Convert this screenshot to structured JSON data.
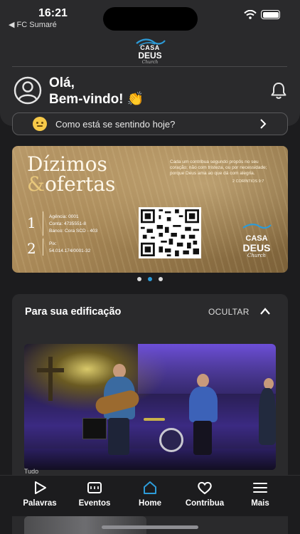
{
  "status": {
    "time": "16:21",
    "back_label": "◀ FC Sumaré"
  },
  "header": {
    "logo_line1": "CASA",
    "logo_line2": "DEUS",
    "logo_script": "Church",
    "greeting_line1": "Olá,",
    "greeting_line2": "Bem-vindo! 👏"
  },
  "mood": {
    "prompt": "Como está se sentindo hoje?"
  },
  "banner": {
    "title_line1": "Dízimos",
    "title_amp": "&",
    "title_line2": "ofertas",
    "verse": "Cada um contribua segundo propôs no seu coração; não com tristeza, ou por necessidade; porque Deus ama ao que dá com alegria.",
    "verse_ref": "2 CORÍNTIOS 9:7",
    "bank_num": "1",
    "bank_agency": "Agência: 0001",
    "bank_account": "Conta: 4735551-8",
    "bank_name": "Banco: Cora SCD - 403",
    "pix_num": "2",
    "pix_label": "Pix:",
    "pix_key": "54.014.174/0001-32",
    "logo_line1": "CASA",
    "logo_line2": "DEUS",
    "logo_script": "Church"
  },
  "carousel": {
    "count": 3,
    "active_index": 1
  },
  "edification": {
    "title": "Para sua edificação",
    "hide_label": "OCULTAR",
    "section_label": "Tudo"
  },
  "tabbar": {
    "items": [
      {
        "label": "Palavras",
        "icon": "play-icon"
      },
      {
        "label": "Eventos",
        "icon": "ticket-icon"
      },
      {
        "label": "Home",
        "icon": "home-icon",
        "active": true
      },
      {
        "label": "Contribua",
        "icon": "heart-icon"
      },
      {
        "label": "Mais",
        "icon": "menu-icon"
      }
    ]
  },
  "colors": {
    "accent": "#2d9bd8",
    "background": "#1c1c1e",
    "card": "#2a2a2c"
  }
}
